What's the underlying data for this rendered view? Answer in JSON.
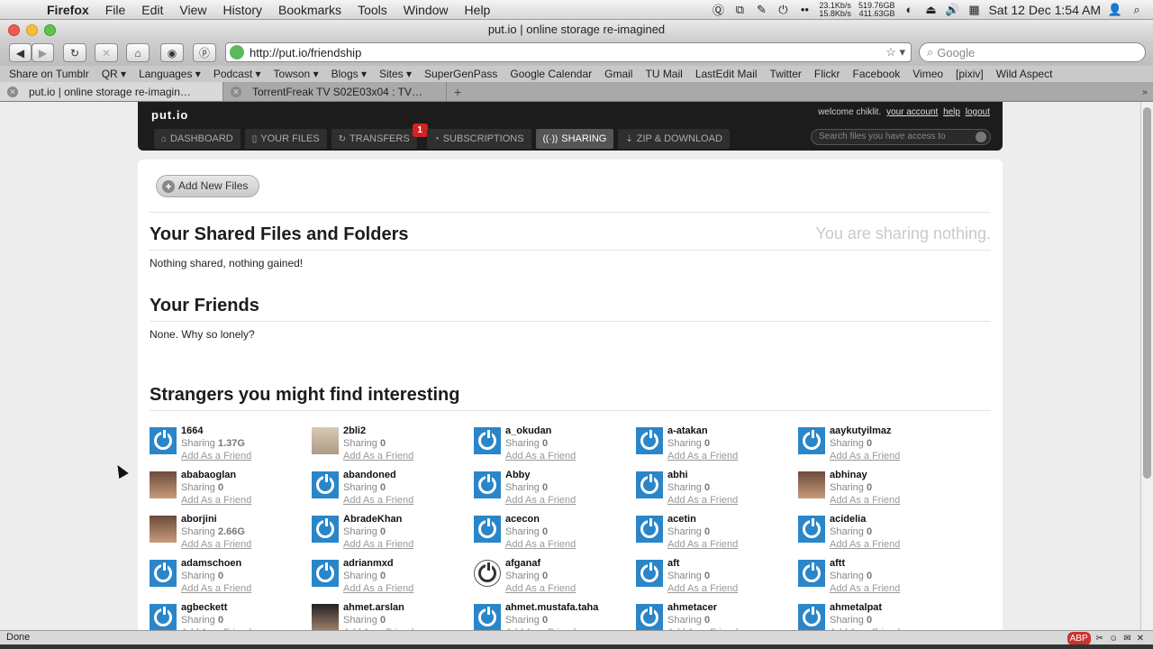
{
  "menubar": {
    "app": "Firefox",
    "items": [
      "File",
      "Edit",
      "View",
      "History",
      "Bookmarks",
      "Tools",
      "Window",
      "Help"
    ],
    "net_up": "23.1Kb/s",
    "net_down": "15.8Kb/s",
    "disk1": "519.76GB",
    "disk2": "411.63GB",
    "clock": "Sat 12 Dec  1:54 AM"
  },
  "window": {
    "title": "put.io | online storage re-imagined"
  },
  "toolbar": {
    "url": "http://put.io/friendship",
    "search_placeholder": "Google"
  },
  "bookmarks": [
    "Share on Tumblr",
    "QR ▾",
    "Languages ▾",
    "Podcast ▾",
    "Towson ▾",
    "Blogs ▾",
    "Sites ▾",
    "SuperGenPass",
    "Google Calendar",
    "Gmail",
    "TU Mail",
    "LastEdit Mail",
    "Twitter",
    "Flickr",
    "Facebook",
    "Vimeo",
    "[pixiv]",
    "Wild Aspect"
  ],
  "tabs": [
    {
      "label": "put.io | online storage re-imagin…"
    },
    {
      "label": "TorrentFreak TV S02E03x04 : TV…"
    }
  ],
  "site": {
    "logo": "put.io",
    "welcome": "welcome chiklit.",
    "links": {
      "account": "your account",
      "help": "help",
      "logout": "logout"
    },
    "nav": [
      {
        "label": "DASHBOARD",
        "icon": "⌂"
      },
      {
        "label": "YOUR FILES",
        "icon": "▯"
      },
      {
        "label": "TRANSFERS",
        "icon": "↻",
        "badge": "1"
      },
      {
        "label": "SUBSCRIPTIONS",
        "icon": "◔"
      },
      {
        "label": "SHARING",
        "icon": "((·))"
      },
      {
        "label": "ZIP & DOWNLOAD",
        "icon": "⇣"
      }
    ],
    "search_placeholder": "Search files you have access to"
  },
  "content": {
    "add_button": "Add New Files",
    "shared_title": "Your Shared Files and Folders",
    "sharing_nothing": "You are sharing nothing.",
    "shared_empty": "Nothing shared, nothing gained!",
    "friends_title": "Your Friends",
    "friends_empty": "None. Why so lonely?",
    "strangers_title": "Strangers you might find interesting",
    "sharing_label": "Sharing",
    "add_friend": "Add As a Friend",
    "strangers": [
      {
        "name": "1664",
        "sharing": "1.37G",
        "avatar": "power"
      },
      {
        "name": "2bli2",
        "sharing": "0",
        "avatar": "photo-light"
      },
      {
        "name": "a_okudan",
        "sharing": "0",
        "avatar": "power"
      },
      {
        "name": "a-atakan",
        "sharing": "0",
        "avatar": "power"
      },
      {
        "name": "aaykutyilmaz",
        "sharing": "0",
        "avatar": "power"
      },
      {
        "name": "ababaoglan",
        "sharing": "0",
        "avatar": "photo"
      },
      {
        "name": "abandoned",
        "sharing": "0",
        "avatar": "power"
      },
      {
        "name": "Abby",
        "sharing": "0",
        "avatar": "power"
      },
      {
        "name": "abhi",
        "sharing": "0",
        "avatar": "power"
      },
      {
        "name": "abhinay",
        "sharing": "0",
        "avatar": "photo"
      },
      {
        "name": "aborjini",
        "sharing": "2.66G",
        "avatar": "photo"
      },
      {
        "name": "AbradeKhan",
        "sharing": "0",
        "avatar": "power"
      },
      {
        "name": "acecon",
        "sharing": "0",
        "avatar": "power"
      },
      {
        "name": "acetin",
        "sharing": "0",
        "avatar": "power"
      },
      {
        "name": "acidelia",
        "sharing": "0",
        "avatar": "power"
      },
      {
        "name": "adamschoen",
        "sharing": "0",
        "avatar": "power"
      },
      {
        "name": "adrianmxd",
        "sharing": "0",
        "avatar": "power"
      },
      {
        "name": "afganaf",
        "sharing": "0",
        "avatar": "logo"
      },
      {
        "name": "aft",
        "sharing": "0",
        "avatar": "power"
      },
      {
        "name": "aftt",
        "sharing": "0",
        "avatar": "power"
      },
      {
        "name": "agbeckett",
        "sharing": "0",
        "avatar": "power"
      },
      {
        "name": "ahmet.arslan",
        "sharing": "0",
        "avatar": "photo-dark"
      },
      {
        "name": "ahmet.mustafa.taha",
        "sharing": "0",
        "avatar": "power"
      },
      {
        "name": "ahmetacer",
        "sharing": "0",
        "avatar": "power"
      },
      {
        "name": "ahmetalpat",
        "sharing": "0",
        "avatar": "power"
      }
    ]
  },
  "status": {
    "text": "Done"
  }
}
